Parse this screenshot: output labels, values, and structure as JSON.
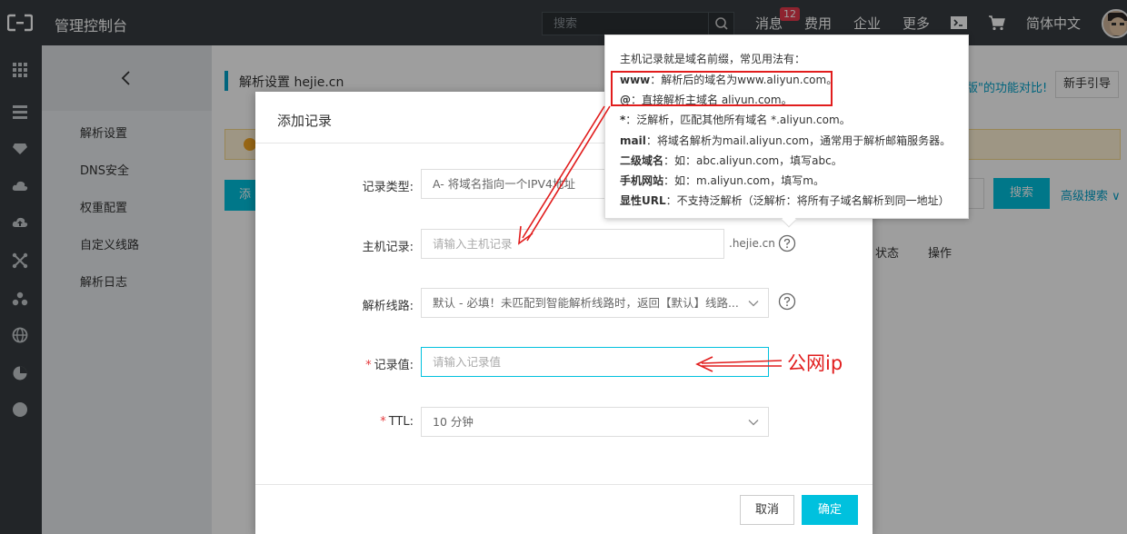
{
  "topbar": {
    "title": "管理控制台",
    "search_placeholder": "搜索",
    "nav": [
      "消息",
      "费用",
      "企业",
      "更多"
    ],
    "message_badge": "12",
    "language": "简体中文"
  },
  "sidebar": {
    "items": [
      {
        "label": "解析设置"
      },
      {
        "label": "DNS安全"
      },
      {
        "label": "权重配置"
      },
      {
        "label": "自定义线路"
      },
      {
        "label": "解析日志"
      }
    ]
  },
  "page": {
    "title": "解析设置 hejie.cn",
    "promo_text": "版\"的功能对比!",
    "guide_button": "新手引导",
    "add_button": "添",
    "search_button": "搜索",
    "advanced_search": "高级搜索 ∨",
    "columns": [
      "状态",
      "操作"
    ]
  },
  "modal": {
    "title": "添加记录",
    "fields": {
      "record_type": {
        "label": "记录类型:",
        "value": "A- 将域名指向一个IPV4地址"
      },
      "host": {
        "label": "主机记录:",
        "placeholder": "请输入主机记录",
        "suffix": ".hejie.cn"
      },
      "line": {
        "label": "解析线路:",
        "value": "默认 - 必填！未匹配到智能解析线路时，返回【默认】线路..."
      },
      "record_value": {
        "label": "记录值:",
        "placeholder": "请输入记录值",
        "required": true
      },
      "ttl": {
        "label": "TTL:",
        "value": "10 分钟",
        "required": true
      }
    },
    "cancel_button": "取消",
    "ok_button": "确定"
  },
  "tooltip": {
    "intro": "主机记录就是域名前缀，常见用法有：",
    "lines": [
      {
        "term": "www",
        "desc": "：解析后的域名为www.aliyun.com。"
      },
      {
        "term": "@",
        "desc": "：直接解析主域名 aliyun.com。"
      },
      {
        "term": "*",
        "desc": "：泛解析，匹配其他所有域名 *.aliyun.com。"
      },
      {
        "term": "mail",
        "desc": "：将域名解析为mail.aliyun.com，通常用于解析邮箱服务器。"
      },
      {
        "term": "二级域名",
        "desc": "：如：abc.aliyun.com，填写abc。"
      },
      {
        "term": "手机网站",
        "desc": "：如：m.aliyun.com，填写m。"
      },
      {
        "term": "显性URL",
        "desc": "：不支持泛解析（泛解析：将所有子域名解析到同一地址）"
      }
    ]
  },
  "annotation": {
    "label": "公网ip",
    "color": "#e11d1d"
  },
  "colors": {
    "topbar_bg": "#373d41",
    "accent": "#00c1de",
    "annotation_red": "#e11d1d"
  }
}
